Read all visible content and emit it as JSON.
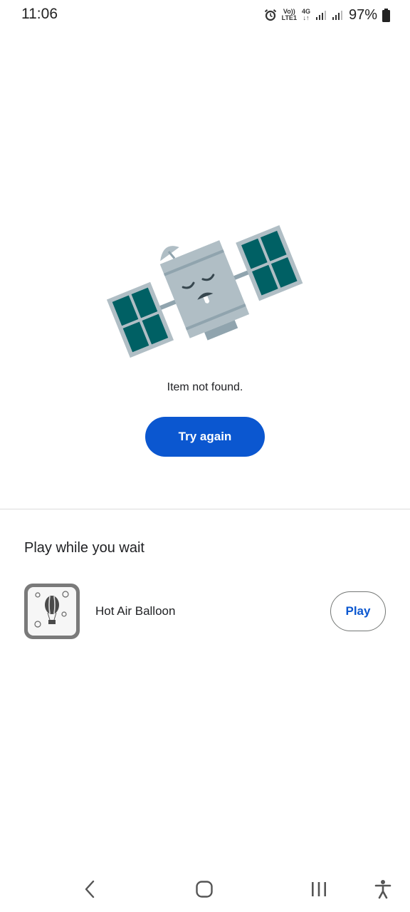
{
  "status_bar": {
    "time": "11:06",
    "volte_label_top": "Vo))",
    "volte_label_bottom": "LTE1",
    "network_label_top": "4G",
    "network_label_bottom": "↓↑",
    "battery_percent": "97%",
    "icons": [
      "alarm-icon",
      "volte-icon",
      "4g-icon",
      "signal-icon",
      "signal-icon",
      "battery-icon"
    ]
  },
  "error": {
    "illustration": "sleeping-satellite",
    "message": "Item not found.",
    "retry_label": "Try again"
  },
  "wait_section": {
    "title": "Play while you wait",
    "game": {
      "name": "Hot Air Balloon",
      "icon": "hot-air-balloon-icon",
      "play_label": "Play"
    }
  },
  "nav_bar": {
    "icons": [
      "back-icon",
      "home-icon",
      "recents-icon",
      "accessibility-icon"
    ]
  },
  "colors": {
    "primary": "#0b57d0",
    "satellite_body": "#b0bec5",
    "satellite_panel": "#006064",
    "divider": "#dcdcdc"
  }
}
